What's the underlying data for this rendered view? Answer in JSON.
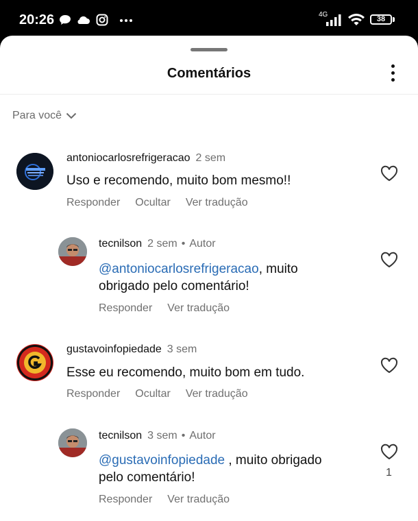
{
  "status_bar": {
    "time": "20:26",
    "network": "4G",
    "battery": "38",
    "icons": [
      "chat-bubble-icon",
      "cloud-icon",
      "instagram-icon",
      "more-dots-icon",
      "signal-icon",
      "wifi-icon",
      "battery-icon"
    ]
  },
  "sheet": {
    "title": "Comentários",
    "filter_label": "Para você"
  },
  "comments": [
    {
      "username": "antoniocarlosrefrigeracao",
      "time": "2 sem",
      "author_badge": "",
      "text": "Uso e recomendo, muito bom mesmo!!",
      "actions": [
        "Responder",
        "Ocultar",
        "Ver tradução"
      ]
    },
    {
      "username": "tecnilson",
      "time": "2 sem",
      "author_badge": "Autor",
      "mention": "@antoniocarlosrefrigeracao",
      "text_line1_rest": ", muito",
      "text_line2": "obrigado pelo comentário!",
      "actions": [
        "Responder",
        "Ver tradução"
      ]
    },
    {
      "username": "gustavoinfopiedade",
      "time": "3 sem",
      "author_badge": "",
      "text": "Esse eu recomendo, muito bom em tudo.",
      "actions": [
        "Responder",
        "Ocultar",
        "Ver tradução"
      ]
    },
    {
      "username": "tecnilson",
      "time": "3 sem",
      "author_badge": "Autor",
      "mention": "@gustavoinfopiedade",
      "text_line1_rest": " , muito obrigado",
      "text_line2": "pelo comentário!",
      "actions": [
        "Responder",
        "Ver tradução"
      ],
      "like_count": "1"
    }
  ],
  "colors": {
    "mention": "#2a6cb5",
    "muted": "#6e6e6e",
    "sheet_bg": "#ffffff"
  }
}
